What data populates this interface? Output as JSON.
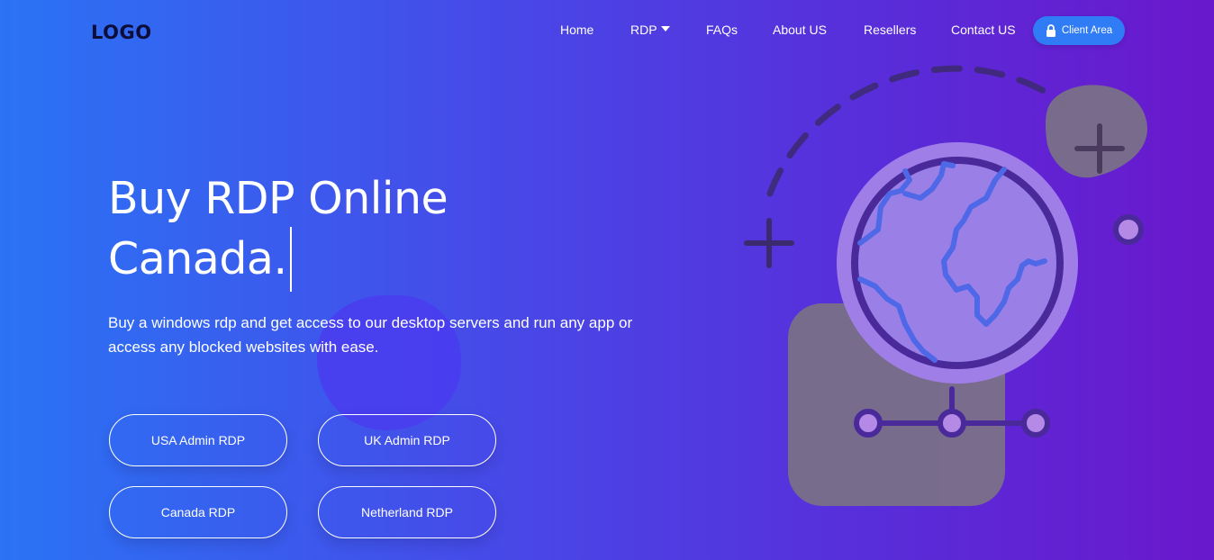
{
  "header": {
    "logo": "LOGO",
    "nav": [
      {
        "label": "Home"
      },
      {
        "label": "RDP"
      },
      {
        "label": "FAQs"
      },
      {
        "label": "About US"
      },
      {
        "label": "Resellers"
      },
      {
        "label": "Contact US"
      }
    ],
    "client_area_label": "Client Area"
  },
  "hero": {
    "title_line1": "Buy RDP Online",
    "title_line2": "Canada.",
    "subtitle": "Buy a windows rdp and get access to our desktop servers and run any app or access any blocked websites with ease."
  },
  "buttons": [
    {
      "label": "USA Admin RDP"
    },
    {
      "label": "UK Admin RDP"
    },
    {
      "label": "Canada RDP"
    },
    {
      "label": "Netherland RDP"
    }
  ],
  "colors": {
    "gradient_start": "#2a73f5",
    "gradient_end": "#6a18cc",
    "client_button": "#2f7cf6",
    "globe_fill": "#a07ee8",
    "globe_stroke": "#4a2a9a"
  },
  "icons": {
    "lock": "lock-icon",
    "caret": "caret-down-icon",
    "globe": "globe-icon"
  }
}
